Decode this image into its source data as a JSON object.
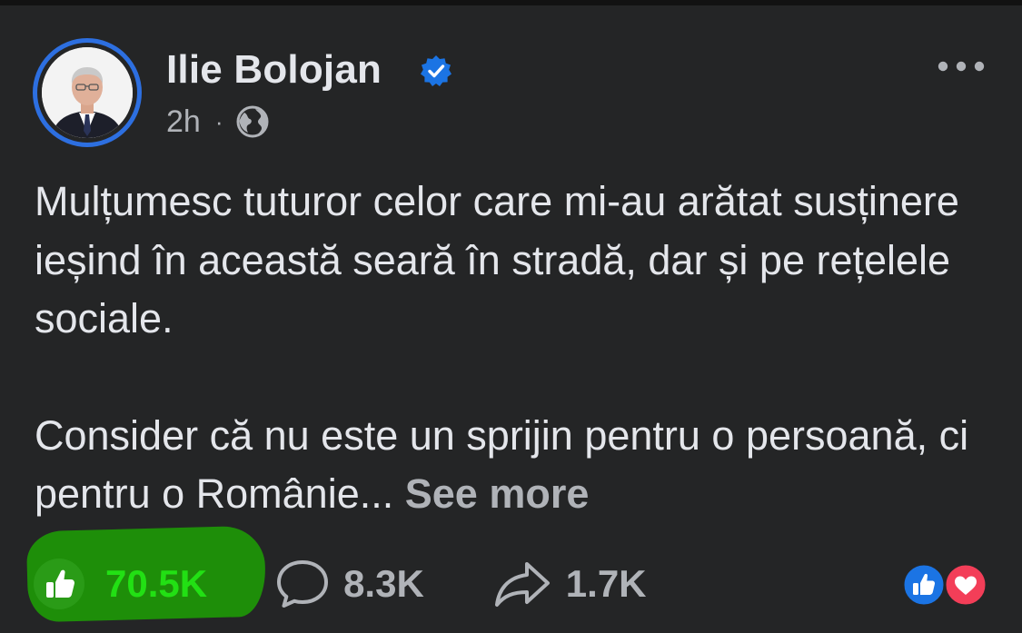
{
  "post": {
    "author": "Ilie Bolojan",
    "verified": true,
    "time": "2h",
    "separator": "·",
    "audience_icon": "globe-icon",
    "paragraphs": [
      "Mulțumesc tuturor celor care mi-au arătat susținere ieșind în această seară în stradă, dar și pe rețelele sociale.",
      "Consider că nu este un sprijin pentru o persoană, ci pentru o Românie..."
    ],
    "see_more": "See more"
  },
  "stats": {
    "likes": "70.5K",
    "comments": "8.3K",
    "shares": "1.7K"
  },
  "reaction_summary": [
    "like-icon",
    "love-icon"
  ],
  "colors": {
    "background": "#242526",
    "text": "#e4e6eb",
    "muted": "#b0b3b8",
    "verified_blue": "#1b74e4",
    "like_highlight": "#1e8e09",
    "like_text": "#22e014",
    "love_red": "#f33e58"
  }
}
